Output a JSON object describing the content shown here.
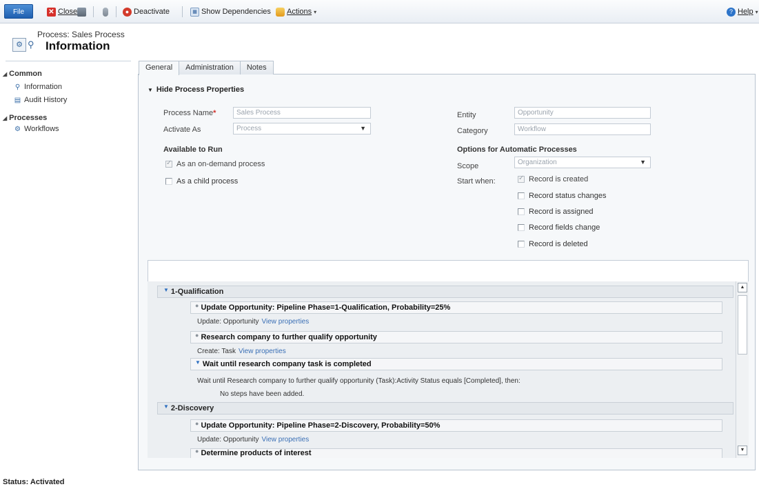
{
  "ribbon": {
    "file": "File",
    "close": "Close",
    "deactivate": "Deactivate",
    "show_dependencies": "Show Dependencies",
    "actions": "Actions",
    "help": "Help"
  },
  "header": {
    "crumb": "Process: Sales Process",
    "title": "Information"
  },
  "nav": {
    "common": "Common",
    "information": "Information",
    "audit_history": "Audit History",
    "processes": "Processes",
    "workflows": "Workflows"
  },
  "tabs": [
    "General",
    "Administration",
    "Notes"
  ],
  "section": {
    "title": "Hide Process Properties"
  },
  "form": {
    "process_name_label": "Process Name",
    "process_name_value": "Sales Process",
    "activate_as_label": "Activate As",
    "activate_as_value": "Process",
    "entity_label": "Entity",
    "entity_value": "Opportunity",
    "category_label": "Category",
    "category_value": "Workflow",
    "available_to_run": "Available to Run",
    "on_demand": "As an on-demand process",
    "child_process": "As a child process",
    "auto_options": "Options for Automatic Processes",
    "scope_label": "Scope",
    "scope_value": "Organization",
    "start_when_label": "Start when:",
    "start_options": [
      "Record is created",
      "Record status changes",
      "Record is assigned",
      "Record fields change",
      "Record is deleted"
    ]
  },
  "steps": {
    "stage1": "1-Qualification",
    "step1": "Update Opportunity: Pipeline Phase=1-Qualification, Probability=25%",
    "step1_detail": "Update:  Opportunity",
    "step2": "Research company to further qualify opportunity",
    "step2_detail": "Create:  Task",
    "step3": "Wait until research company task is completed",
    "step3_detail": "Wait until Research company to further qualify opportunity (Task):Activity Status equals [Completed], then:",
    "no_steps": "No steps have been added.",
    "stage2": "2-Discovery",
    "step4": "Update Opportunity: Pipeline Phase=2-Discovery, Probability=50%",
    "step4_detail": "Update:  Opportunity",
    "step5": "Determine products of interest",
    "view_properties": "View properties"
  },
  "status": {
    "label": "Status: Activated"
  }
}
